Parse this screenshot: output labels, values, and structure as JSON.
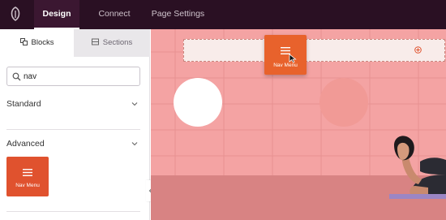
{
  "topbar": {
    "tabs": [
      {
        "label": "Design",
        "active": true
      },
      {
        "label": "Connect",
        "active": false
      },
      {
        "label": "Page Settings",
        "active": false
      }
    ]
  },
  "sidebar": {
    "tabs": [
      {
        "label": "Blocks",
        "icon": "blocks-icon",
        "active": true
      },
      {
        "label": "Sections",
        "icon": "sections-icon",
        "active": false
      }
    ],
    "search": {
      "value": "nav",
      "placeholder": ""
    },
    "sections": [
      {
        "title": "Standard",
        "expanded": false
      },
      {
        "title": "Advanced",
        "expanded": true
      }
    ],
    "advanced_blocks": [
      {
        "label": "Nav Menu",
        "icon": "hamburger-icon"
      }
    ]
  },
  "canvas": {
    "dragged_block": {
      "label": "Nav Menu",
      "icon": "hamburger-icon"
    }
  },
  "colors": {
    "topbar": "#2a1023",
    "accent": "#e0522e",
    "canvas_bg": "#f4a3a3"
  }
}
